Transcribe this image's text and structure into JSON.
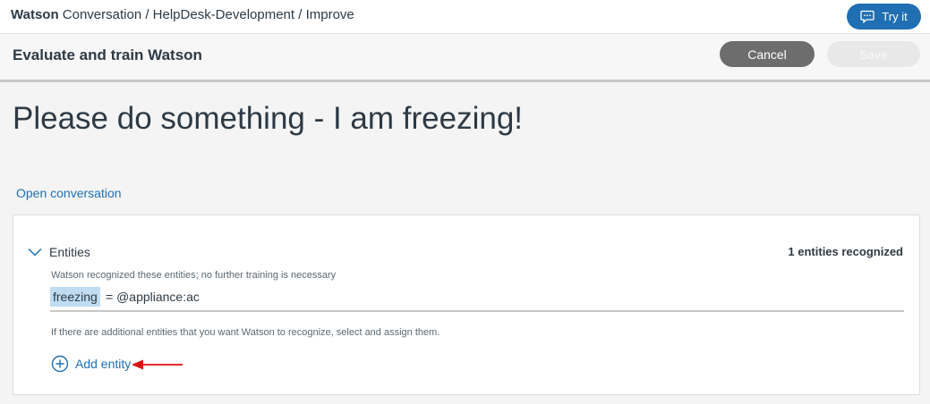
{
  "topbar": {
    "brand": "Watson",
    "breadcrumb": "Conversation / HelpDesk-Development / Improve",
    "try_it_label": "Try it"
  },
  "subbar": {
    "title": "Evaluate and train Watson",
    "cancel_label": "Cancel",
    "save_label": "Save"
  },
  "main": {
    "headline": "Please do something - I am freezing!",
    "open_conversation_label": "Open conversation"
  },
  "entities_panel": {
    "title": "Entities",
    "recognized_count": "1 entities recognized",
    "recognized_note": "Watson recognized these entities; no further training is necessary",
    "entity": {
      "token": "freezing",
      "assignment": "= @appliance:ac"
    },
    "additional_note": "If there are additional entities that you want Watson to recognize, select and assign them.",
    "add_entity_label": "Add entity"
  },
  "colors": {
    "accent": "#1f6fb2",
    "annotation_arrow": "#e01010",
    "entity_highlight": "#bfdcf2"
  },
  "icons": {
    "try_it": "chat-bubble-icon",
    "collapse": "chevron-down-icon",
    "add": "plus-circle-icon",
    "annotation": "red-arrow-icon"
  }
}
